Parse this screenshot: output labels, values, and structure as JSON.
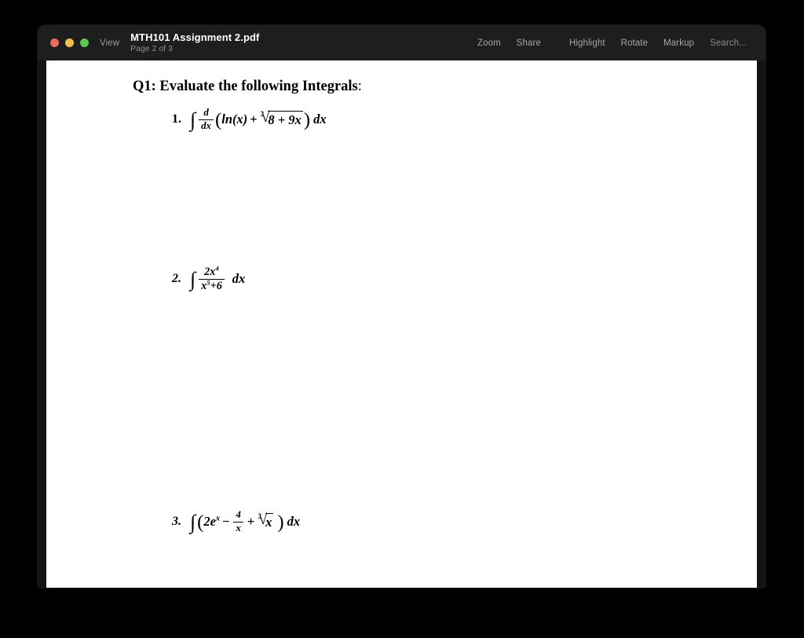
{
  "window": {
    "traffic_lights": [
      {
        "name": "close",
        "color": "#ec6a5e"
      },
      {
        "name": "minimize",
        "color": "#f3bf4f"
      },
      {
        "name": "maximize",
        "color": "#61c454"
      }
    ],
    "view_label": "View",
    "document_title": "MTH101 Assignment 2.pdf",
    "page_indicator": "Page 2 of 3",
    "toolbar": {
      "group_a": [
        "Zoom",
        "Share"
      ],
      "group_b": [
        "Highlight",
        "Rotate",
        "Markup",
        "Search..."
      ]
    }
  },
  "document": {
    "heading": {
      "text": "Q1: Evaluate the following Integrals",
      "colon": ":"
    },
    "items": [
      {
        "number": "1.",
        "expression": "∫ d/dx ( ln(x) + ∛(8 + 9x) ) dx",
        "parts": {
          "integral": "∫",
          "frac_num": "d",
          "frac_den": "dx",
          "open_paren": "(",
          "ln": "ln(x)",
          "plus": "+",
          "root_index": "3",
          "root_sign": "√",
          "radicand": "8 + 9x",
          "close_paren": ")",
          "dx": "dx"
        }
      },
      {
        "number": "2.",
        "expression": "∫ 2x⁴/(x⁵+6) dx",
        "parts": {
          "integral": "∫",
          "num_base": "2x",
          "num_exp": "4",
          "den_base": "x",
          "den_exp": "5",
          "den_rest": "+6",
          "dx": "dx"
        }
      },
      {
        "number": "3.",
        "expression": "∫(2eˣ − 4/x + ∛x) dx",
        "parts": {
          "integral": "∫",
          "open_paren": "(",
          "term1_base": "2e",
          "term1_exp": "x",
          "minus": "−",
          "frac_num": "4",
          "frac_den": "x",
          "plus": "+",
          "root_index": "3",
          "root_sign": "√",
          "radicand": "x",
          "close_paren": ")",
          "dx": "dx"
        }
      }
    ]
  }
}
